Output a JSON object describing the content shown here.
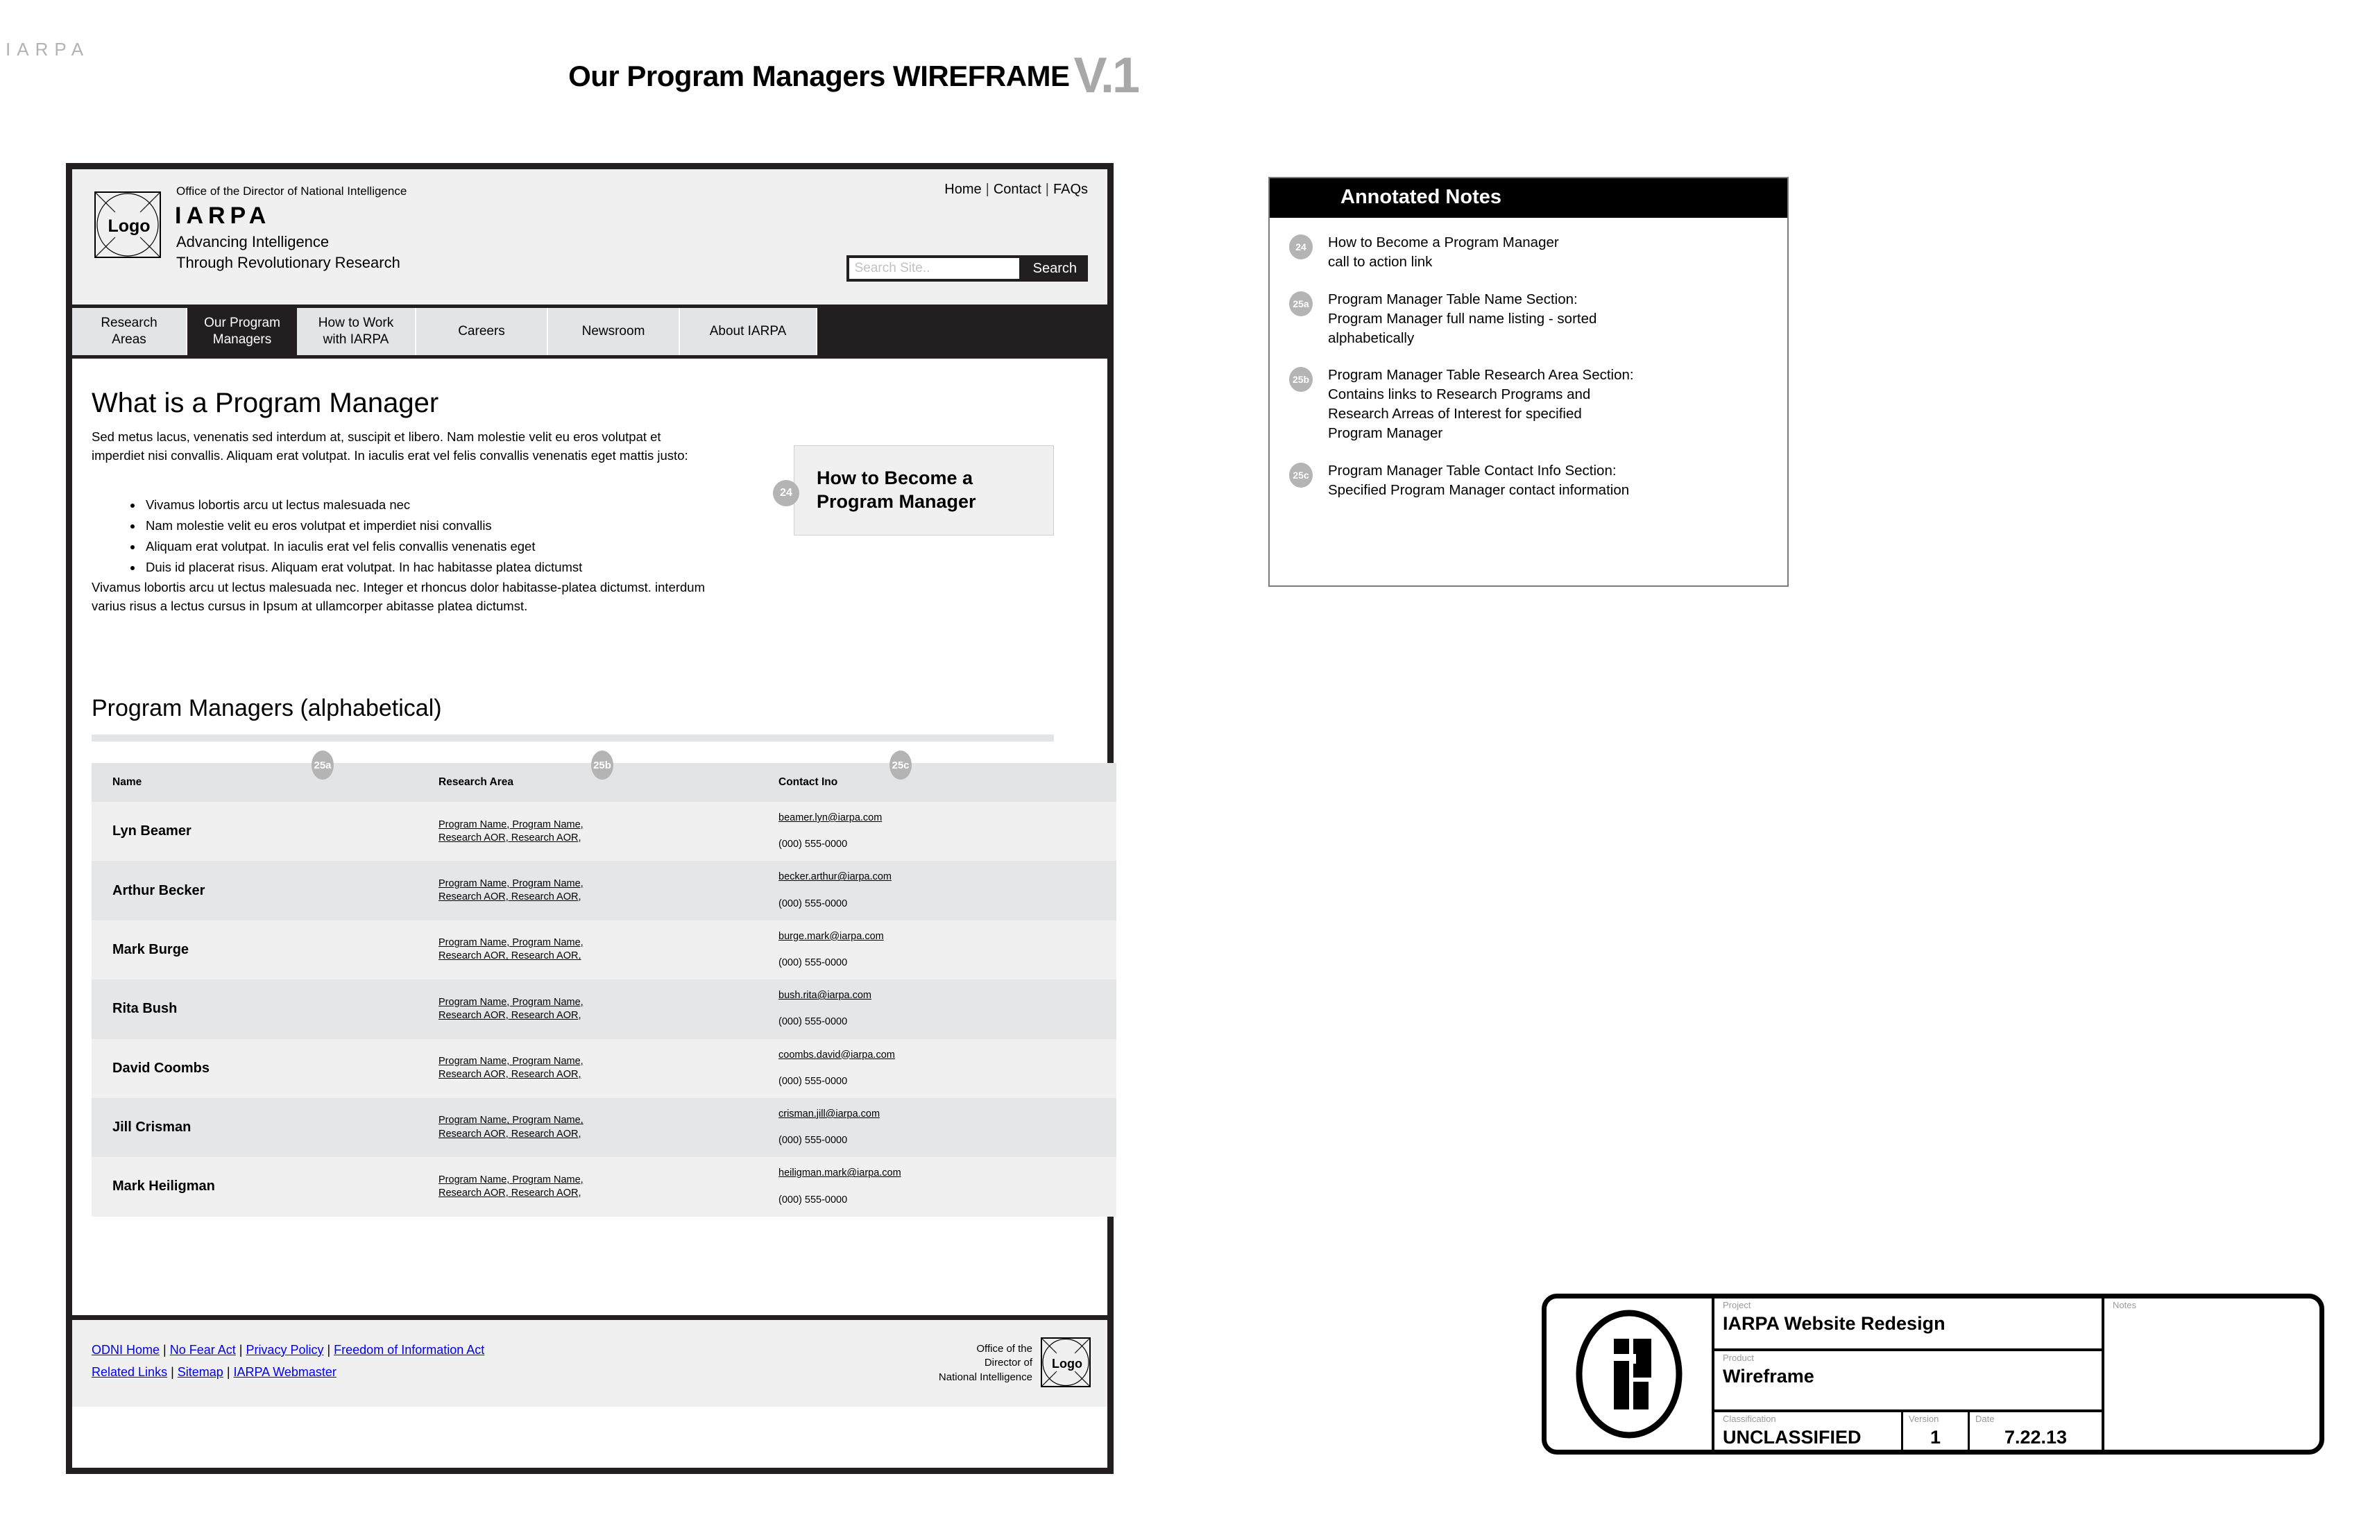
{
  "doc": {
    "title": "Our Program Managers WIREFRAME",
    "brandmark": "IARPA",
    "version_label": "V.1"
  },
  "site_header": {
    "logo_text": "Logo",
    "odni_line": "Office of the Director of National Intelligence",
    "brand": "IARPA",
    "tagline_line1": "Advancing Intelligence",
    "tagline_line2": "Through Revolutionary Research",
    "util_nav": [
      "Home",
      "Contact",
      "FAQs"
    ],
    "search_placeholder": "Search Site..",
    "search_value": "",
    "search_button": "Search"
  },
  "main_nav": [
    {
      "line1": "Research",
      "line2": "Areas",
      "active": false
    },
    {
      "line1": "Our Program",
      "line2": "Managers",
      "active": true
    },
    {
      "line1": "How to Work",
      "line2": "with IARPA",
      "active": false
    },
    {
      "line1": "Careers",
      "line2": "",
      "active": false
    },
    {
      "line1": "Newsroom",
      "line2": "",
      "active": false
    },
    {
      "line1": "About IARPA",
      "line2": "",
      "active": false
    }
  ],
  "content": {
    "heading": "What is a Program Manager",
    "intro": "Sed metus lacus, venenatis sed interdum at, suscipit et libero. Nam molestie velit eu eros volutpat et imperdiet nisi convallis. Aliquam erat volutpat. In iaculis erat vel felis convallis venenatis eget mattis justo:",
    "bullets": [
      "Vivamus lobortis arcu ut lectus malesuada nec",
      "Nam molestie velit eu eros volutpat et imperdiet nisi convallis",
      "Aliquam erat volutpat. In iaculis erat vel felis convallis venenatis eget",
      "Duis id placerat risus. Aliquam erat volutpat. In hac habitasse platea dictumst"
    ],
    "after_paragraph": "Vivamus lobortis arcu ut lectus malesuada nec. Integer et rhoncus dolor habitasse-platea dictumst. interdum varius risus a lectus cursus in Ipsum at ullamcorper abitasse platea dictumst.",
    "cta_line1": "How to Become a",
    "cta_line2": "Program Manager",
    "cta_marker": "24"
  },
  "table": {
    "heading": "Program Managers (alphabetical)",
    "markers": {
      "name": "25a",
      "area": "25b",
      "contact": "25c"
    },
    "columns": [
      "Name",
      "Research Area",
      "Contact Ino"
    ],
    "area_line1": "Program Name, Program Name,",
    "area_line2": "Research AOR, Research AOR,",
    "phone": "(000) 555-0000",
    "rows": [
      {
        "name": "Lyn Beamer",
        "email": "beamer.lyn@iarpa.com"
      },
      {
        "name": "Arthur Becker",
        "email": "becker.arthur@iarpa.com"
      },
      {
        "name": "Mark Burge",
        "email": "burge.mark@iarpa.com"
      },
      {
        "name": "Rita Bush",
        "email": "bush.rita@iarpa.com"
      },
      {
        "name": "David Coombs",
        "email": "coombs.david@iarpa.com"
      },
      {
        "name": "Jill Crisman",
        "email": "crisman.jill@iarpa.com"
      },
      {
        "name": "Mark Heiligman",
        "email": "heiligman.mark@iarpa.com"
      }
    ]
  },
  "site_footer": {
    "links_row1": [
      "ODNI Home",
      "No Fear Act",
      "Privacy Policy",
      "Freedom of Information Act"
    ],
    "links_row2": [
      "Related Links",
      "Sitemap",
      "IARPA Webmaster"
    ],
    "odni_line1": "Office of the",
    "odni_line2": "Director of",
    "odni_line3": "National Intelligence",
    "logo_text": "Logo"
  },
  "notes": {
    "title": "Annotated Notes",
    "items": [
      {
        "marker": "24",
        "text": "How to Become a Program Manager\ncall to action link"
      },
      {
        "marker": "25a",
        "text": "Program Manager Table Name Section:\nProgram Manager full name listing - sorted\nalphabetically"
      },
      {
        "marker": "25b",
        "text": "Program Manager Table Research Area Section:\nContains links to Research Programs and\nResearch Arreas of Interest for specified\nProgram Manager"
      },
      {
        "marker": "25c",
        "text": "Program Manager Table Contact Info Section:\nSpecified Program Manager contact information"
      }
    ]
  },
  "title_block": {
    "project_label": "Project",
    "project_value": "IARPA Website Redesign",
    "product_label": "Product",
    "product_value": "Wireframe",
    "classification_label": "Classification",
    "classification_value": "UNCLASSIFIED",
    "version_label": "Version",
    "version_value": "1",
    "date_label": "Date",
    "date_value": "7.22.13",
    "notes_label": "Notes",
    "notes_value": ""
  },
  "colors": {
    "ink": "#231f20",
    "panel": "#f0f0f0",
    "band": "#e2e4e6",
    "marker": "#b4b4b4"
  }
}
